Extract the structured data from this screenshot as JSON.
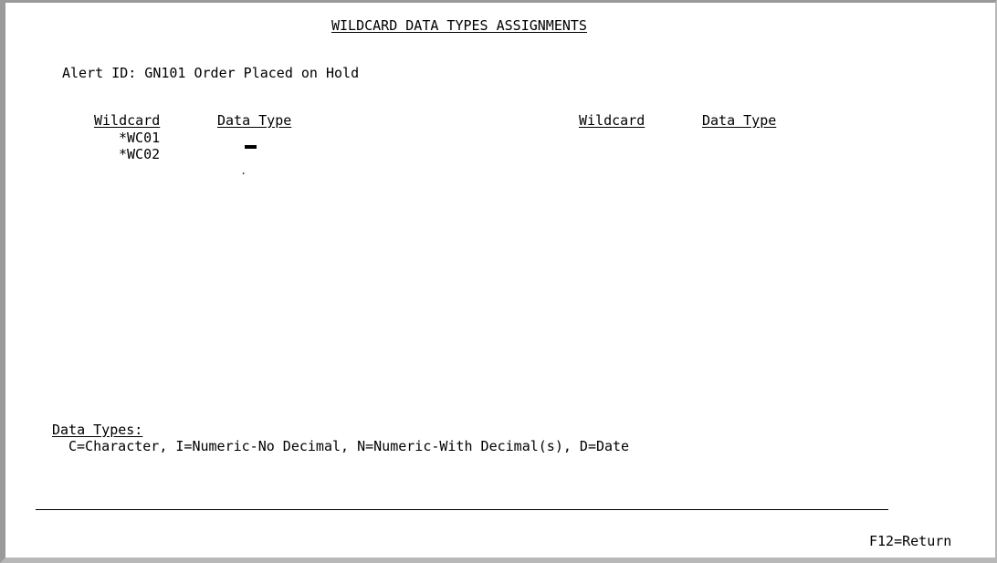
{
  "screen": {
    "title": "WILDCARD DATA TYPES ASSIGNMENTS",
    "alert_line": "Alert ID: GN101 Order Placed on Hold"
  },
  "columns": {
    "left_wildcard_header": "Wildcard",
    "left_datatype_header": "Data Type",
    "right_wildcard_header": "Wildcard",
    "right_datatype_header": "Data Type"
  },
  "rows": [
    {
      "wildcard": "*WC01",
      "data_type": ""
    },
    {
      "wildcard": "*WC02",
      "data_type": ". ."
    }
  ],
  "legend": {
    "heading": "Data Types:",
    "text": "C=Character, I=Numeric-No Decimal, N=Numeric-With Decimal(s), D=Date"
  },
  "function_keys": {
    "f12": "F12=Return"
  }
}
